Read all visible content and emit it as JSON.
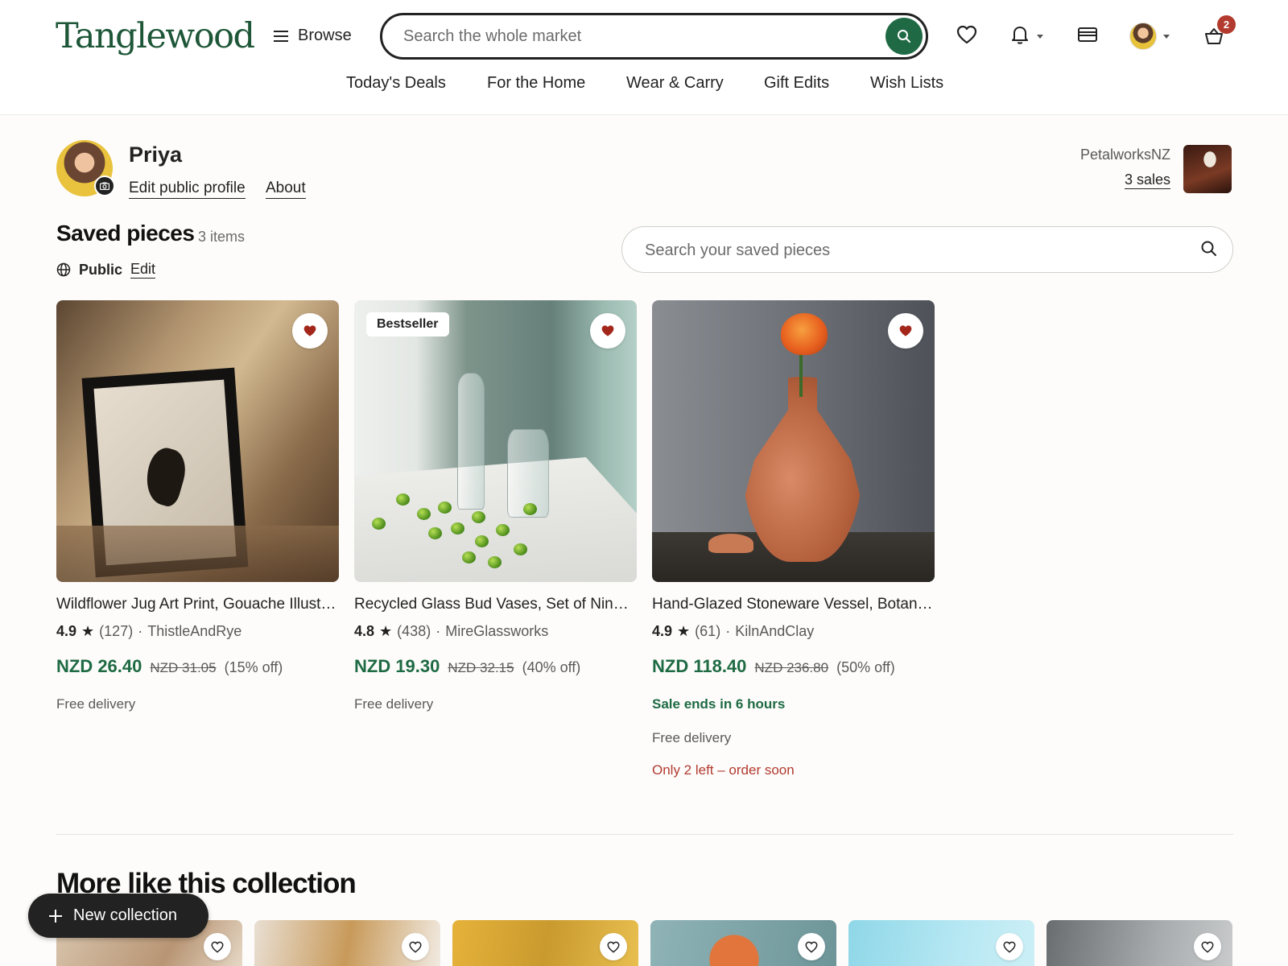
{
  "header": {
    "logo": "Tanglewood",
    "browse_label": "Browse",
    "search_placeholder": "Search the whole market",
    "cart_count": "2",
    "icons": [
      "menu-icon",
      "search-icon",
      "heart-icon",
      "bell-icon",
      "gift-card-icon",
      "avatar",
      "basket-icon"
    ]
  },
  "nav": {
    "items": [
      "Today's Deals",
      "For the Home",
      "Wear & Carry",
      "Gift Edits",
      "Wish Lists"
    ]
  },
  "profile": {
    "name": "Priya",
    "edit_link": "Edit public profile",
    "about_link": "About",
    "shop_name": "PetalworksNZ",
    "shop_sales": "3 sales"
  },
  "saved": {
    "title": "Saved pieces",
    "count": "3 items",
    "visibility": "Public",
    "edit": "Edit",
    "search_placeholder": "Search your saved pieces"
  },
  "cards": [
    {
      "title": "Wildflower Jug Art Print, Gouache Illustration",
      "rating": "4.9",
      "reviews": "(127)",
      "seller": "ThistleAndRye",
      "price": "NZD 26.40",
      "was": "NZD 31.05",
      "off": "(15% off)",
      "delivery": "Free delivery",
      "tag": "",
      "sale": "",
      "low": ""
    },
    {
      "title": "Recycled Glass Bud Vases, Set of Nine Clear",
      "rating": "4.8",
      "reviews": "(438)",
      "seller": "MireGlassworks",
      "price": "NZD 19.30",
      "was": "NZD 32.15",
      "off": "(40% off)",
      "delivery": "Free delivery",
      "tag": "Bestseller",
      "sale": "",
      "low": ""
    },
    {
      "title": "Hand-Glazed Stoneware Vessel, Botanical Carved",
      "rating": "4.9",
      "reviews": "(61)",
      "seller": "KilnAndClay",
      "price": "NZD 118.40",
      "was": "NZD 236.80",
      "off": "(50% off)",
      "delivery": "Free delivery",
      "tag": "",
      "sale": "Sale ends in 6 hours",
      "low": "Only 2 left – order soon"
    }
  ],
  "more": {
    "title": "More like this collection",
    "new_collection": "New collection"
  },
  "colors": {
    "brand_green": "#1e5638",
    "price_green": "#1e6a43",
    "alert_red": "#b23a2e",
    "heart_red": "#a3261b"
  }
}
